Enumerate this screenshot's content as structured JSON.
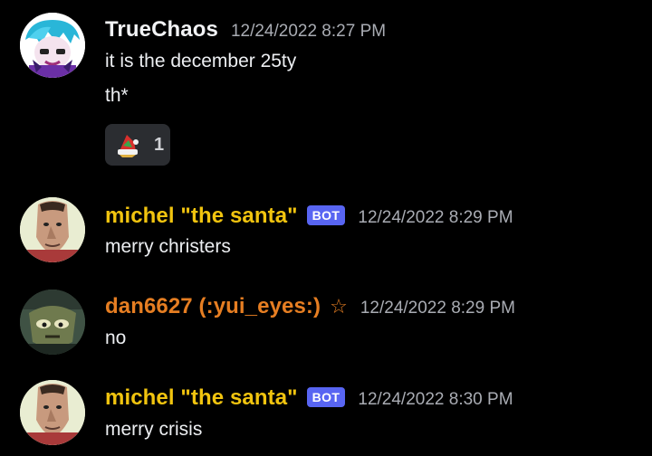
{
  "colors": {
    "background": "#000000",
    "username_default": "#f2f3f5",
    "username_gold": "#f1c40f",
    "username_orange": "#e67e22",
    "bot_tag": "#5865f2",
    "timestamp": "#a9acb3"
  },
  "messages": [
    {
      "author": "TrueChaos",
      "timestamp": "12/24/2022 8:27 PM",
      "avatar_icon": "cartoon-character-avatar",
      "lines": [
        "it is the december 25ty",
        "th*"
      ],
      "reaction": {
        "emoji_icon": "santa-hat-emoji",
        "count": "1"
      }
    },
    {
      "author": "michel \"the santa\"",
      "bot_label": "BOT",
      "timestamp": "12/24/2022 8:29 PM",
      "avatar_icon": "stretched-face-avatar",
      "lines": [
        "merry christers"
      ]
    },
    {
      "author": "dan6627 (:yui_eyes:)",
      "star": "☆",
      "timestamp": "12/24/2022 8:29 PM",
      "avatar_icon": "dark-character-avatar",
      "lines": [
        "no"
      ]
    },
    {
      "author": "michel \"the santa\"",
      "bot_label": "BOT",
      "timestamp": "12/24/2022 8:30 PM",
      "avatar_icon": "stretched-face-avatar",
      "lines": [
        "merry crisis"
      ]
    }
  ]
}
